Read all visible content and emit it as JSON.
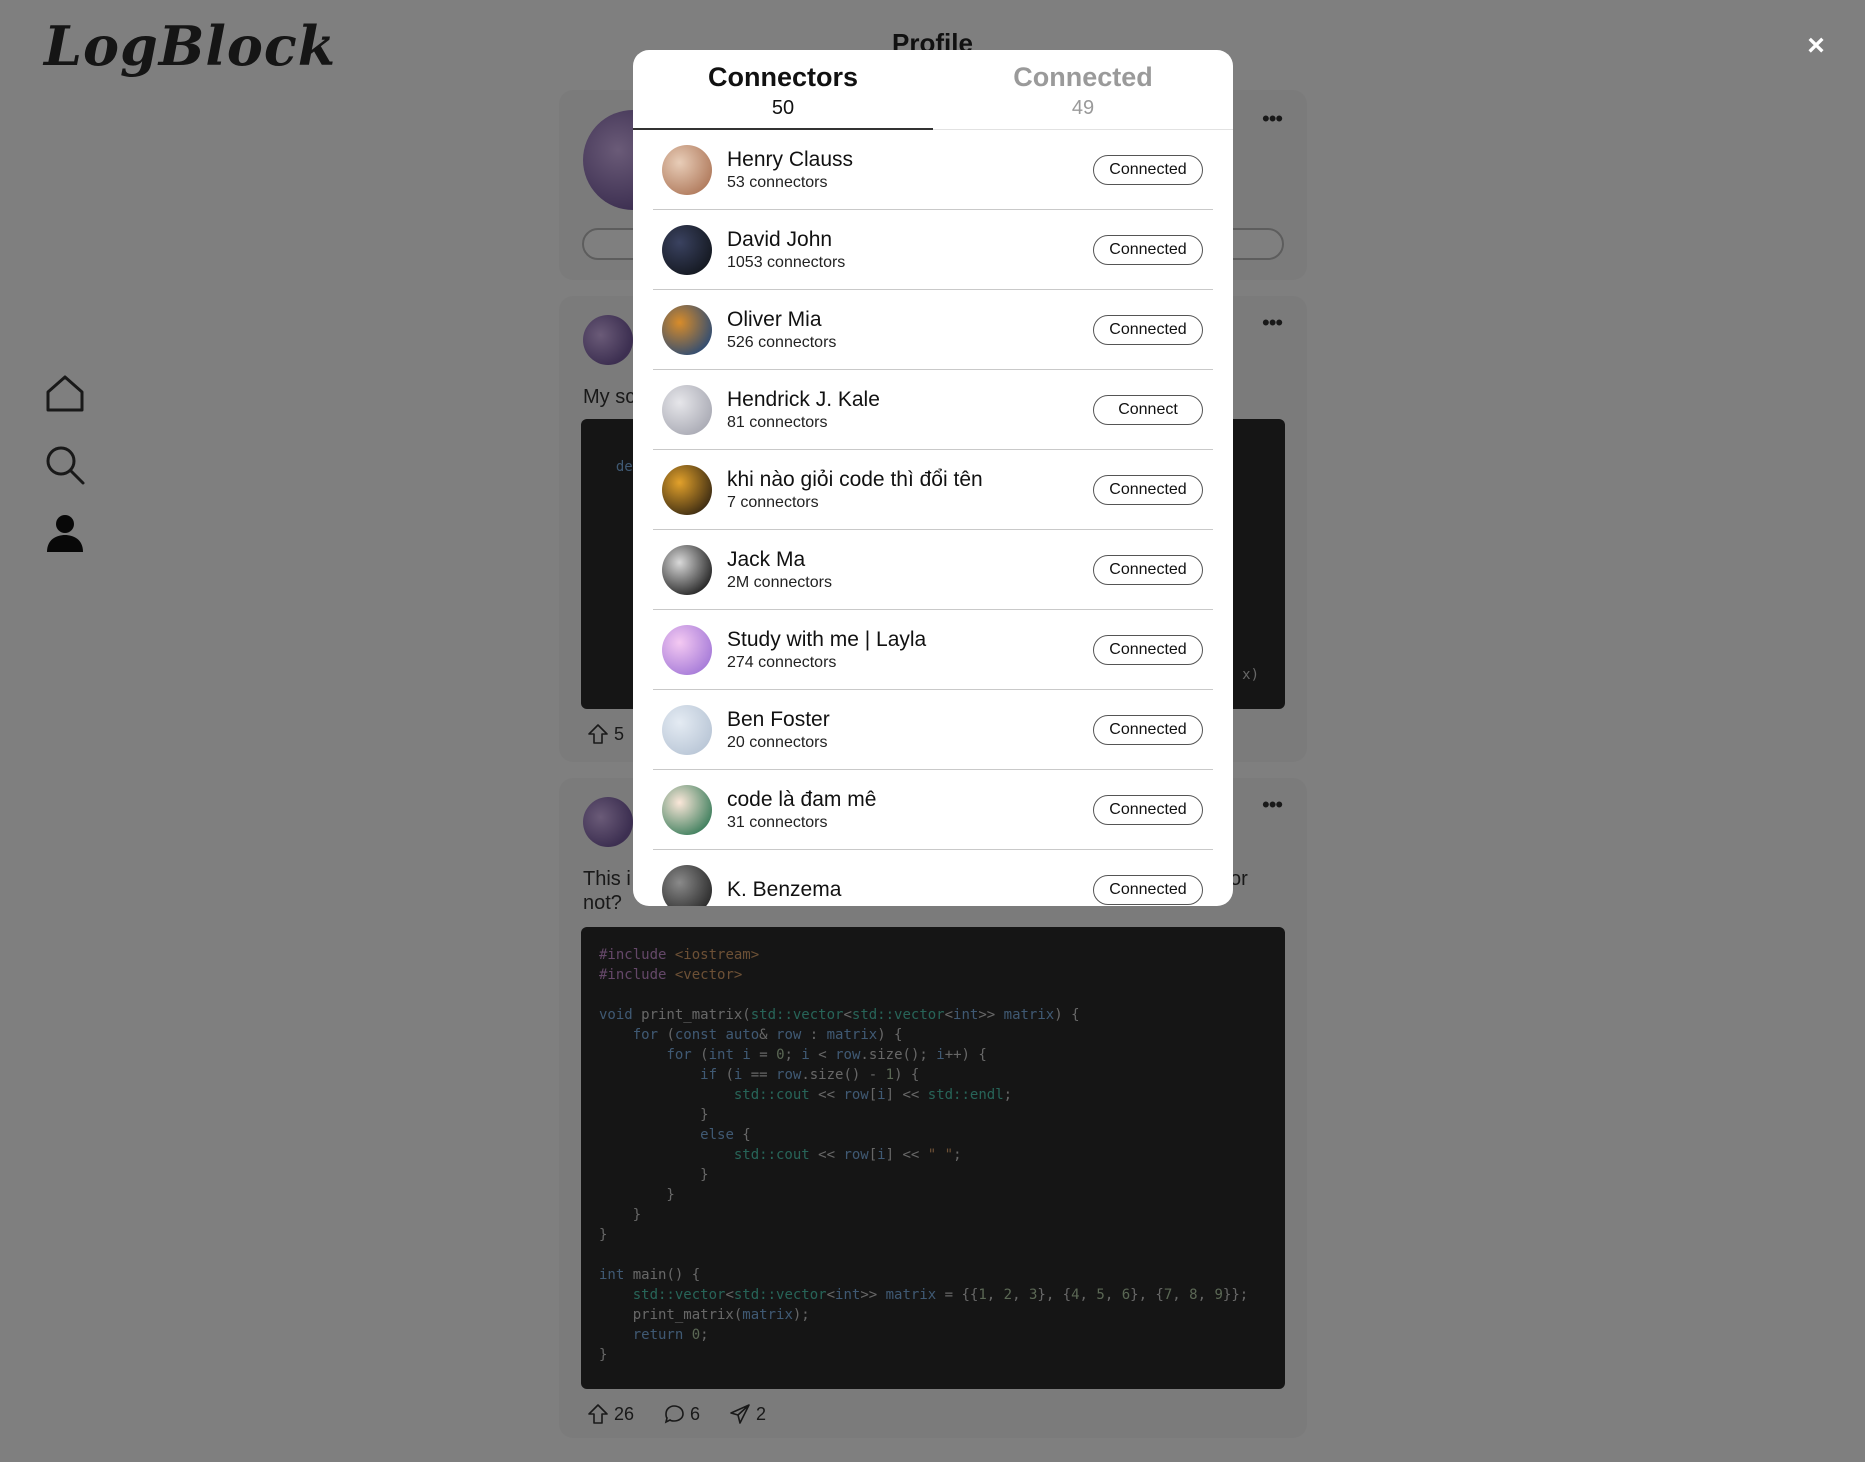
{
  "app": {
    "logo": "LogBlock",
    "page_title": "Profile"
  },
  "nav": {
    "items": [
      "home-icon",
      "search-icon",
      "profile-icon"
    ]
  },
  "posts": [
    {
      "text_partial": "My sc",
      "code_partial_start": "def",
      "code_partial_end": "x)",
      "upvotes": "5"
    },
    {
      "text_line1_start": "This i",
      "text_line1_end": "or",
      "text_line2": "not?",
      "upvotes": "26",
      "comments": "6",
      "shares": "2"
    }
  ],
  "modal": {
    "tabs": [
      {
        "label": "Connectors",
        "count": "50",
        "active": true
      },
      {
        "label": "Connected",
        "count": "49",
        "active": false
      }
    ],
    "rows": [
      {
        "name": "Henry Clauss",
        "sub": "53 connectors",
        "button": "Connected",
        "avatar_colors": [
          "#e8cdb8",
          "#b07a5c"
        ]
      },
      {
        "name": "David John",
        "sub": "1053 connectors",
        "button": "Connected",
        "avatar_colors": [
          "#3a4260",
          "#141820"
        ]
      },
      {
        "name": "Oliver Mia",
        "sub": "526 connectors",
        "button": "Connected",
        "avatar_colors": [
          "#d88c2a",
          "#2d4b74"
        ]
      },
      {
        "name": "Hendrick J. Kale",
        "sub": "81 connectors",
        "button": "Connect",
        "avatar_colors": [
          "#e6e6ea",
          "#a9aab4"
        ]
      },
      {
        "name": "khi nào giỏi code thì đổi tên",
        "sub": "7 connectors",
        "button": "Connected",
        "avatar_colors": [
          "#e2a12b",
          "#3a2a12"
        ]
      },
      {
        "name": "Jack Ma",
        "sub": "2M connectors",
        "button": "Connected",
        "avatar_colors": [
          "#d9d9d9",
          "#222222"
        ]
      },
      {
        "name": "Study with me | Layla",
        "sub": "274 connectors",
        "button": "Connected",
        "avatar_colors": [
          "#f4c9f2",
          "#a57ad8"
        ]
      },
      {
        "name": "Ben Foster",
        "sub": "20 connectors",
        "button": "Connected",
        "avatar_colors": [
          "#e4ebf3",
          "#b9c6d6"
        ]
      },
      {
        "name": "code là đam mê",
        "sub": "31 connectors",
        "button": "Connected",
        "avatar_colors": [
          "#fbe7d9",
          "#3b7d5b"
        ]
      },
      {
        "name": "K. Benzema",
        "sub": "",
        "button": "Connected",
        "avatar_colors": [
          "#8a8a8a",
          "#2a2a2a"
        ]
      }
    ]
  },
  "close_label": "×"
}
